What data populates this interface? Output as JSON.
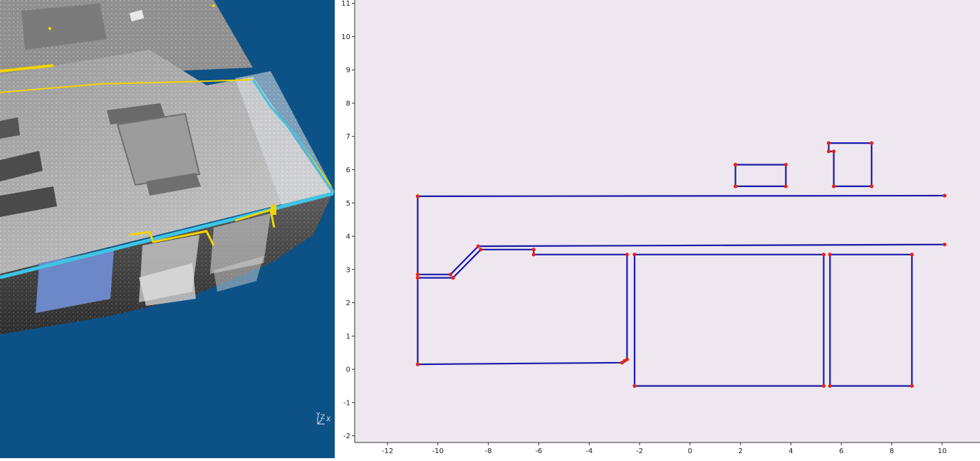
{
  "viewport": {
    "background": "#0d5287",
    "orientation_axes": [
      "Y",
      "Z",
      "X"
    ]
  },
  "plot": {
    "background": "#efe7f0",
    "line_color": "#1a1aa8",
    "vertex_color": "#e0241c"
  },
  "chart_data": {
    "type": "line",
    "title": "",
    "xlabel": "",
    "ylabel": "",
    "xlim": [
      -13.3,
      11.5
    ],
    "ylim": [
      -2.2,
      11.1
    ],
    "x_ticks": [
      -12,
      -10,
      -8,
      -6,
      -4,
      -2,
      0,
      2,
      4,
      6,
      8,
      10
    ],
    "y_ticks": [
      -2,
      -1,
      0,
      1,
      2,
      3,
      4,
      5,
      6,
      7,
      8,
      9,
      10,
      11
    ],
    "x_tick_labels": [
      "-12",
      "-10",
      "-8",
      "-6",
      "-4",
      "-2",
      "0",
      "2",
      "4",
      "6",
      "8",
      "10"
    ],
    "y_tick_labels": [
      "-2",
      "-1",
      "0",
      "1",
      "2",
      "3",
      "4",
      "5",
      "6",
      "7",
      "8",
      "9",
      "10",
      "11"
    ],
    "grid": false,
    "series": [
      {
        "values": [
          [
            -10.8,
            5.2
          ],
          [
            10.1,
            5.22
          ]
        ]
      },
      {
        "values": [
          [
            -10.8,
            5.2
          ],
          [
            -10.8,
            0.15
          ],
          [
            -2.7,
            0.2
          ],
          [
            -2.6,
            0.25
          ],
          [
            -2.5,
            0.3
          ],
          [
            -2.5,
            3.45
          ],
          [
            -6.2,
            3.45
          ],
          [
            -6.2,
            3.6
          ],
          [
            -8.3,
            3.6
          ],
          [
            -9.4,
            2.75
          ],
          [
            -10.8,
            2.75
          ]
        ]
      },
      {
        "values": [
          [
            -10.8,
            2.85
          ],
          [
            -9.5,
            2.85
          ],
          [
            -8.4,
            3.7
          ],
          [
            10.1,
            3.75
          ]
        ]
      },
      {
        "values": [
          [
            -2.2,
            3.45
          ],
          [
            5.3,
            3.45
          ],
          [
            5.3,
            -0.5
          ],
          [
            -2.2,
            -0.5
          ],
          [
            -2.2,
            3.45
          ]
        ]
      },
      {
        "values": [
          [
            5.55,
            3.45
          ],
          [
            8.8,
            3.45
          ],
          [
            8.8,
            -0.5
          ],
          [
            5.55,
            -0.5
          ],
          [
            5.55,
            3.45
          ]
        ]
      },
      {
        "values": [
          [
            1.8,
            6.15
          ],
          [
            3.8,
            6.15
          ],
          [
            3.8,
            5.5
          ],
          [
            1.8,
            5.5
          ],
          [
            1.8,
            6.15
          ]
        ]
      },
      {
        "values": [
          [
            5.5,
            6.8
          ],
          [
            7.2,
            6.8
          ],
          [
            7.2,
            5.5
          ],
          [
            5.7,
            5.5
          ],
          [
            5.7,
            6.55
          ],
          [
            5.5,
            6.55
          ],
          [
            5.5,
            6.8
          ]
        ]
      }
    ]
  }
}
